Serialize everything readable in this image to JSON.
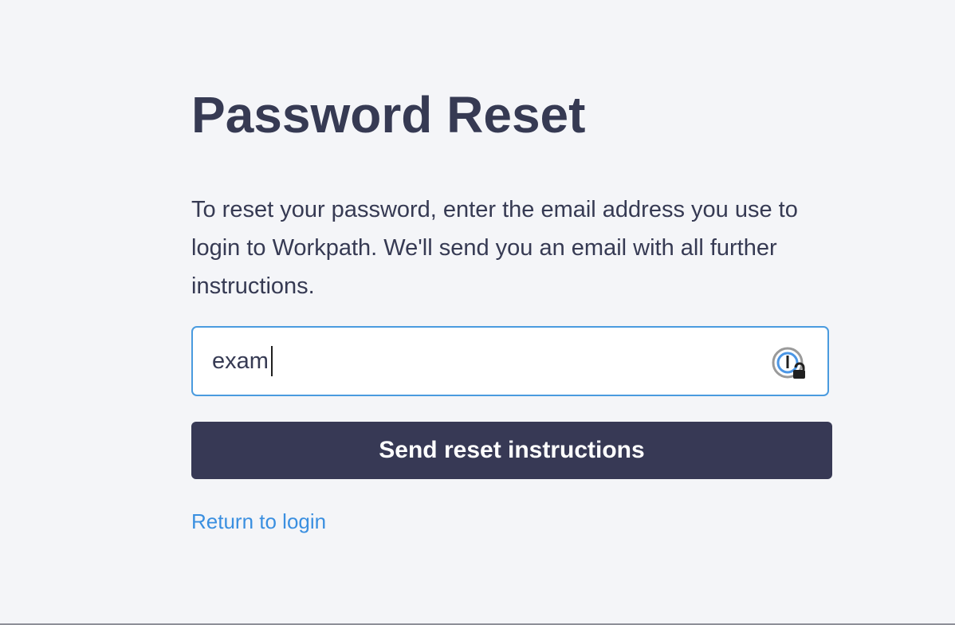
{
  "page": {
    "title": "Password Reset",
    "description": "To reset your password, enter the email address you use to login to Workpath. We'll send you an email with all further instructions."
  },
  "form": {
    "email_value": "exam",
    "password_manager_icon": "password-manager-lock-icon",
    "submit_label": "Send reset instructions",
    "return_link_label": "Return to login"
  },
  "colors": {
    "background": "#f4f5f8",
    "text": "#363a53",
    "button": "#373955",
    "link": "#3a8fe0",
    "input_border": "#4a9bdf"
  }
}
